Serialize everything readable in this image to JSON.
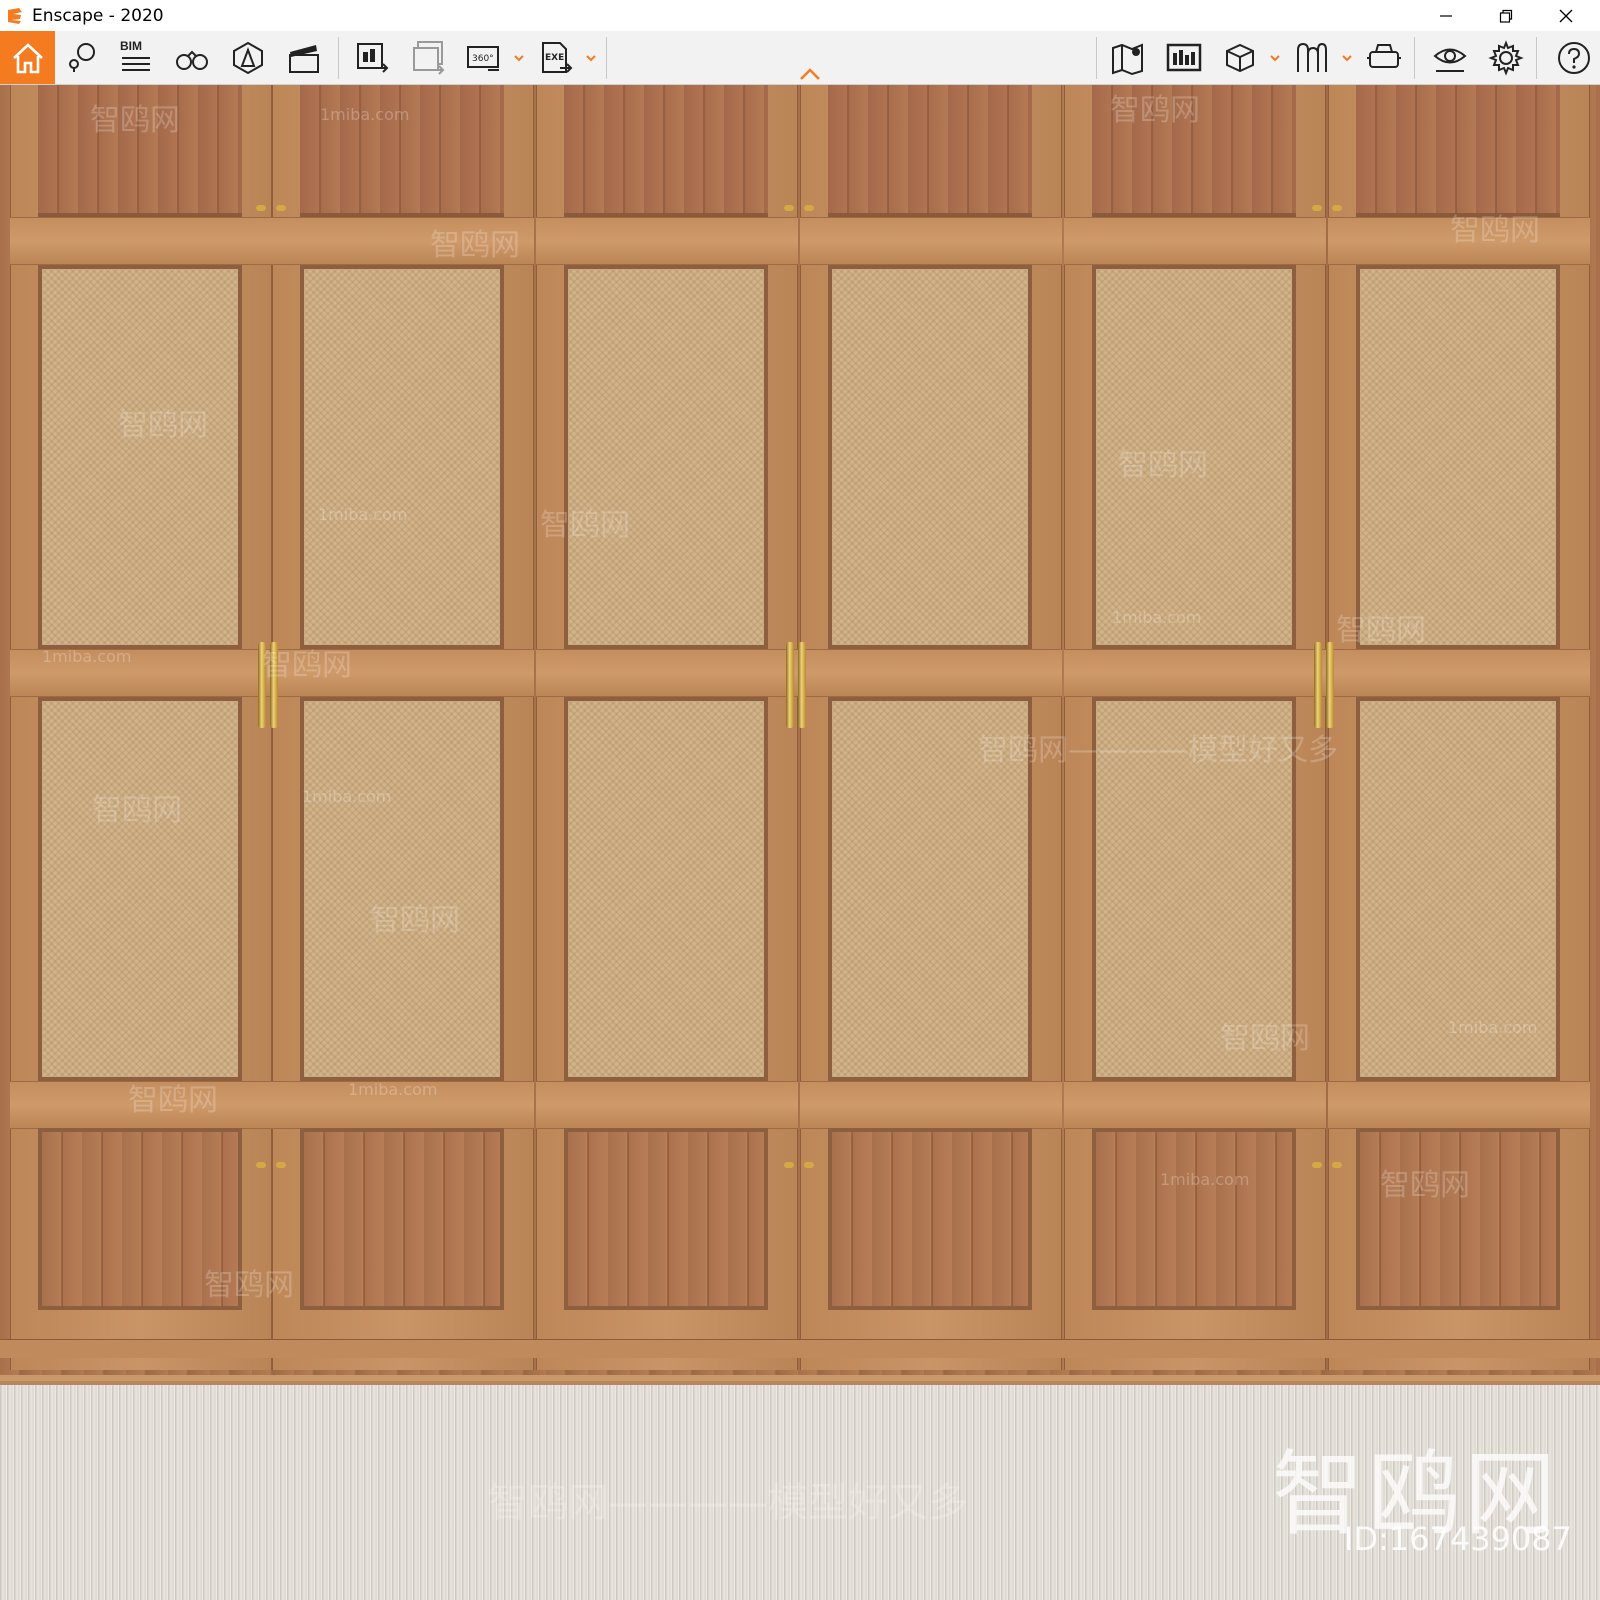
{
  "window": {
    "title": "Enscape - 2020",
    "minimize_label": "minimize",
    "restore_label": "restore",
    "close_label": "close"
  },
  "toolbar": {
    "home": "home-icon",
    "bim_label": "BIM",
    "left_tools": [
      "place-marker-icon",
      "bim-info-icon",
      "binoculars-icon",
      "light-view-icon",
      "video-editor-icon",
      "render-image-icon",
      "batch-render-icon",
      "render-360-icon",
      "export-exe-icon"
    ],
    "right_tools": [
      "map-icon",
      "views-management-icon",
      "asset-library-icon",
      "material-editor-icon",
      "vr-headset-icon",
      "visual-settings-icon",
      "settings-icon",
      "help-icon"
    ],
    "accent_color": "#f47b20"
  },
  "viewport": {
    "watermark_brand": "智鸥网",
    "watermark_slogan": "智鸥网————模型好又多",
    "watermark_url": "1miba.com",
    "watermark_id": "ID:167439087"
  }
}
